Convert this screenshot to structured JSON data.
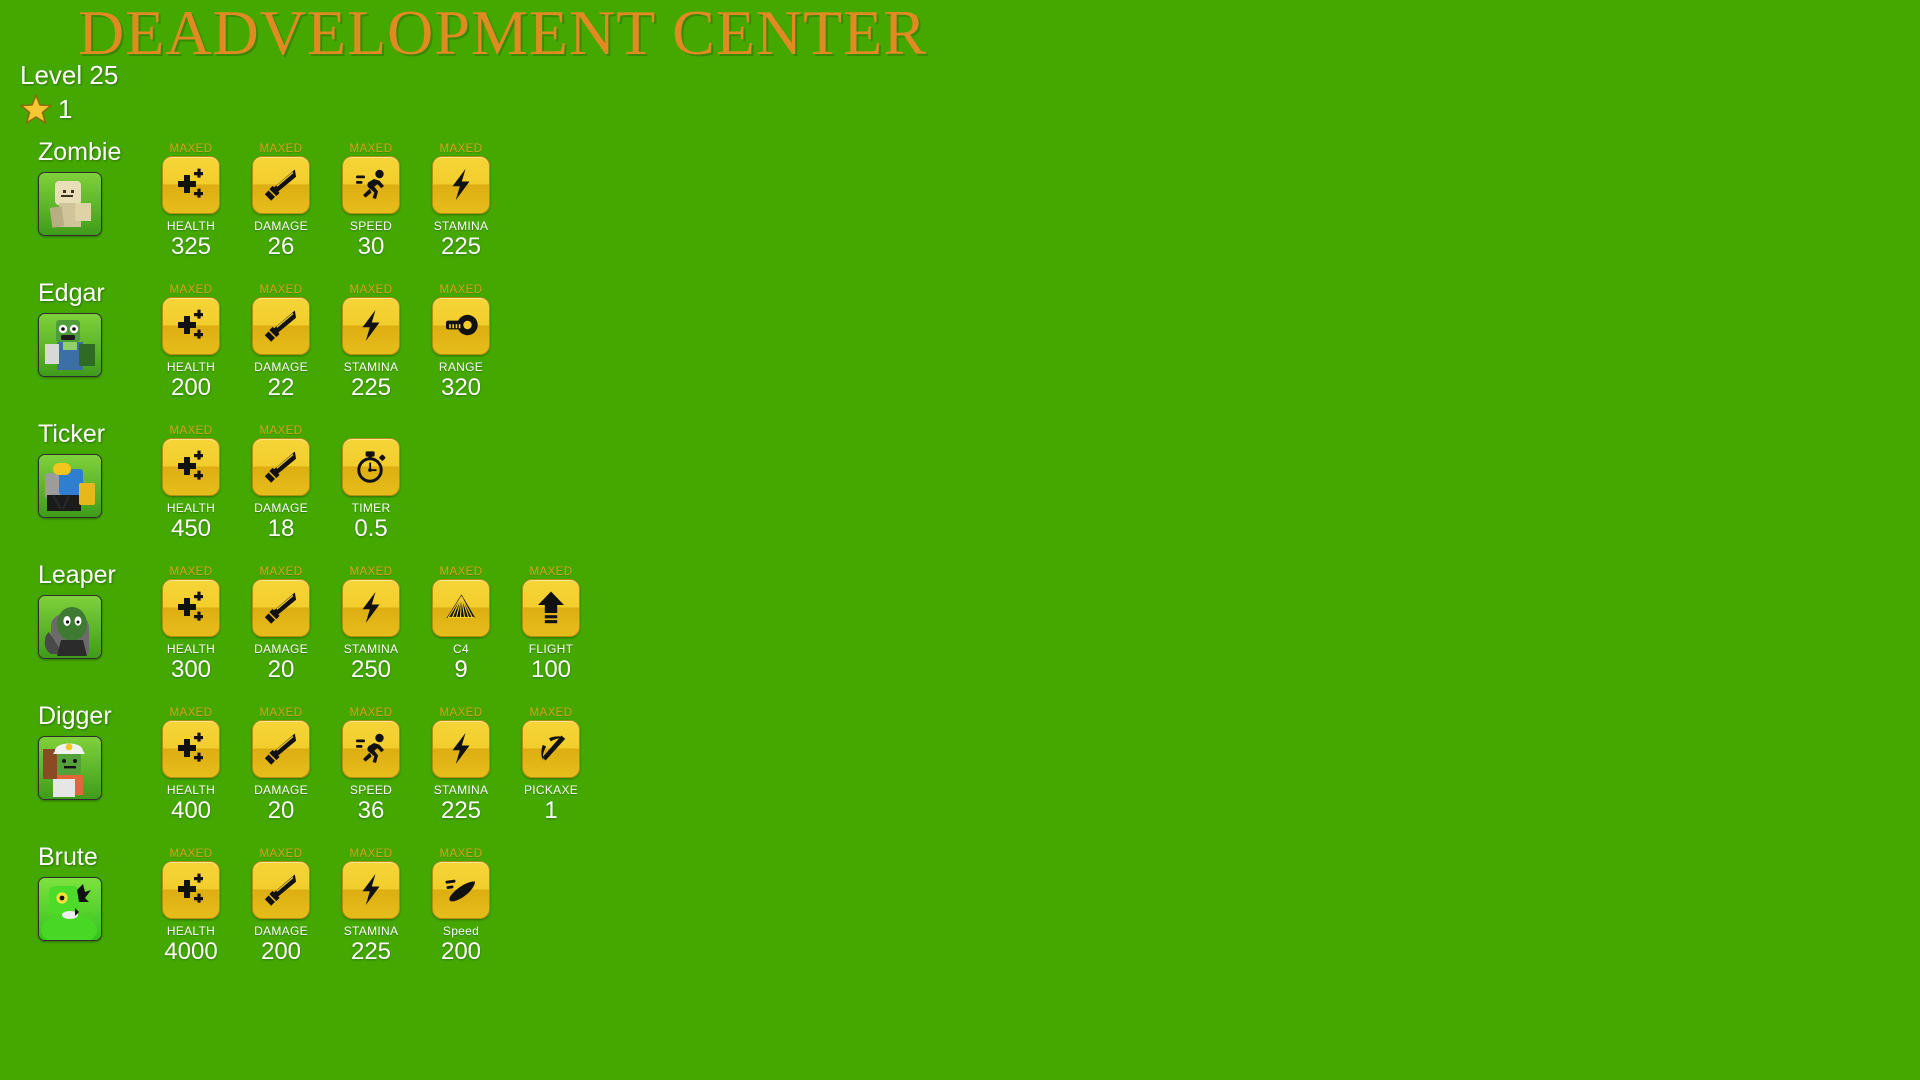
{
  "page": {
    "title": "DEADVELOPMENT CENTER",
    "background_color": "#44a800",
    "title_color": "#e08a22"
  },
  "player": {
    "level_text": "Level 25",
    "star_count": "1",
    "star_color": "#f2c12c"
  },
  "maxed_label": "MAXED",
  "characters": [
    {
      "name": "Zombie",
      "avatar": "zombie-avatar",
      "stats": [
        {
          "icon": "health-icon",
          "label": "HEALTH",
          "value": "325",
          "maxed": true
        },
        {
          "icon": "sword-icon",
          "label": "DAMAGE",
          "value": "26",
          "maxed": true
        },
        {
          "icon": "runner-icon",
          "label": "SPEED",
          "value": "30",
          "maxed": true
        },
        {
          "icon": "bolt-icon",
          "label": "STAMINA",
          "value": "225",
          "maxed": true
        }
      ]
    },
    {
      "name": "Edgar",
      "avatar": "edgar-avatar",
      "stats": [
        {
          "icon": "health-icon",
          "label": "HEALTH",
          "value": "200",
          "maxed": true
        },
        {
          "icon": "sword-icon",
          "label": "DAMAGE",
          "value": "22",
          "maxed": true
        },
        {
          "icon": "bolt-icon",
          "label": "STAMINA",
          "value": "225",
          "maxed": true
        },
        {
          "icon": "tape-measure-icon",
          "label": "RANGE",
          "value": "320",
          "maxed": true
        }
      ]
    },
    {
      "name": "Ticker",
      "avatar": "ticker-avatar",
      "stats": [
        {
          "icon": "health-icon",
          "label": "HEALTH",
          "value": "450",
          "maxed": true
        },
        {
          "icon": "sword-icon",
          "label": "DAMAGE",
          "value": "18",
          "maxed": true
        },
        {
          "icon": "stopwatch-icon",
          "label": "TIMER",
          "value": "0.5",
          "maxed": false
        }
      ]
    },
    {
      "name": "Leaper",
      "avatar": "leaper-avatar",
      "stats": [
        {
          "icon": "health-icon",
          "label": "HEALTH",
          "value": "300",
          "maxed": true
        },
        {
          "icon": "sword-icon",
          "label": "DAMAGE",
          "value": "20",
          "maxed": true
        },
        {
          "icon": "bolt-icon",
          "label": "STAMINA",
          "value": "250",
          "maxed": true
        },
        {
          "icon": "explosion-icon",
          "label": "C4",
          "value": "9",
          "maxed": true
        },
        {
          "icon": "up-arrow-icon",
          "label": "FLIGHT",
          "value": "100",
          "maxed": true
        }
      ]
    },
    {
      "name": "Digger",
      "avatar": "digger-avatar",
      "stats": [
        {
          "icon": "health-icon",
          "label": "HEALTH",
          "value": "400",
          "maxed": true
        },
        {
          "icon": "sword-icon",
          "label": "DAMAGE",
          "value": "20",
          "maxed": true
        },
        {
          "icon": "runner-icon",
          "label": "SPEED",
          "value": "36",
          "maxed": true
        },
        {
          "icon": "bolt-icon",
          "label": "STAMINA",
          "value": "225",
          "maxed": true
        },
        {
          "icon": "pickaxe-icon",
          "label": "PICKAXE",
          "value": "1",
          "maxed": true
        }
      ]
    },
    {
      "name": "Brute",
      "avatar": "brute-avatar",
      "stats": [
        {
          "icon": "health-icon",
          "label": "HEALTH",
          "value": "4000",
          "maxed": true
        },
        {
          "icon": "sword-icon",
          "label": "DAMAGE",
          "value": "200",
          "maxed": true
        },
        {
          "icon": "bolt-icon",
          "label": "STAMINA",
          "value": "225",
          "maxed": true
        },
        {
          "icon": "dash-icon",
          "label": "Speed",
          "value": "200",
          "maxed": true
        }
      ]
    }
  ]
}
